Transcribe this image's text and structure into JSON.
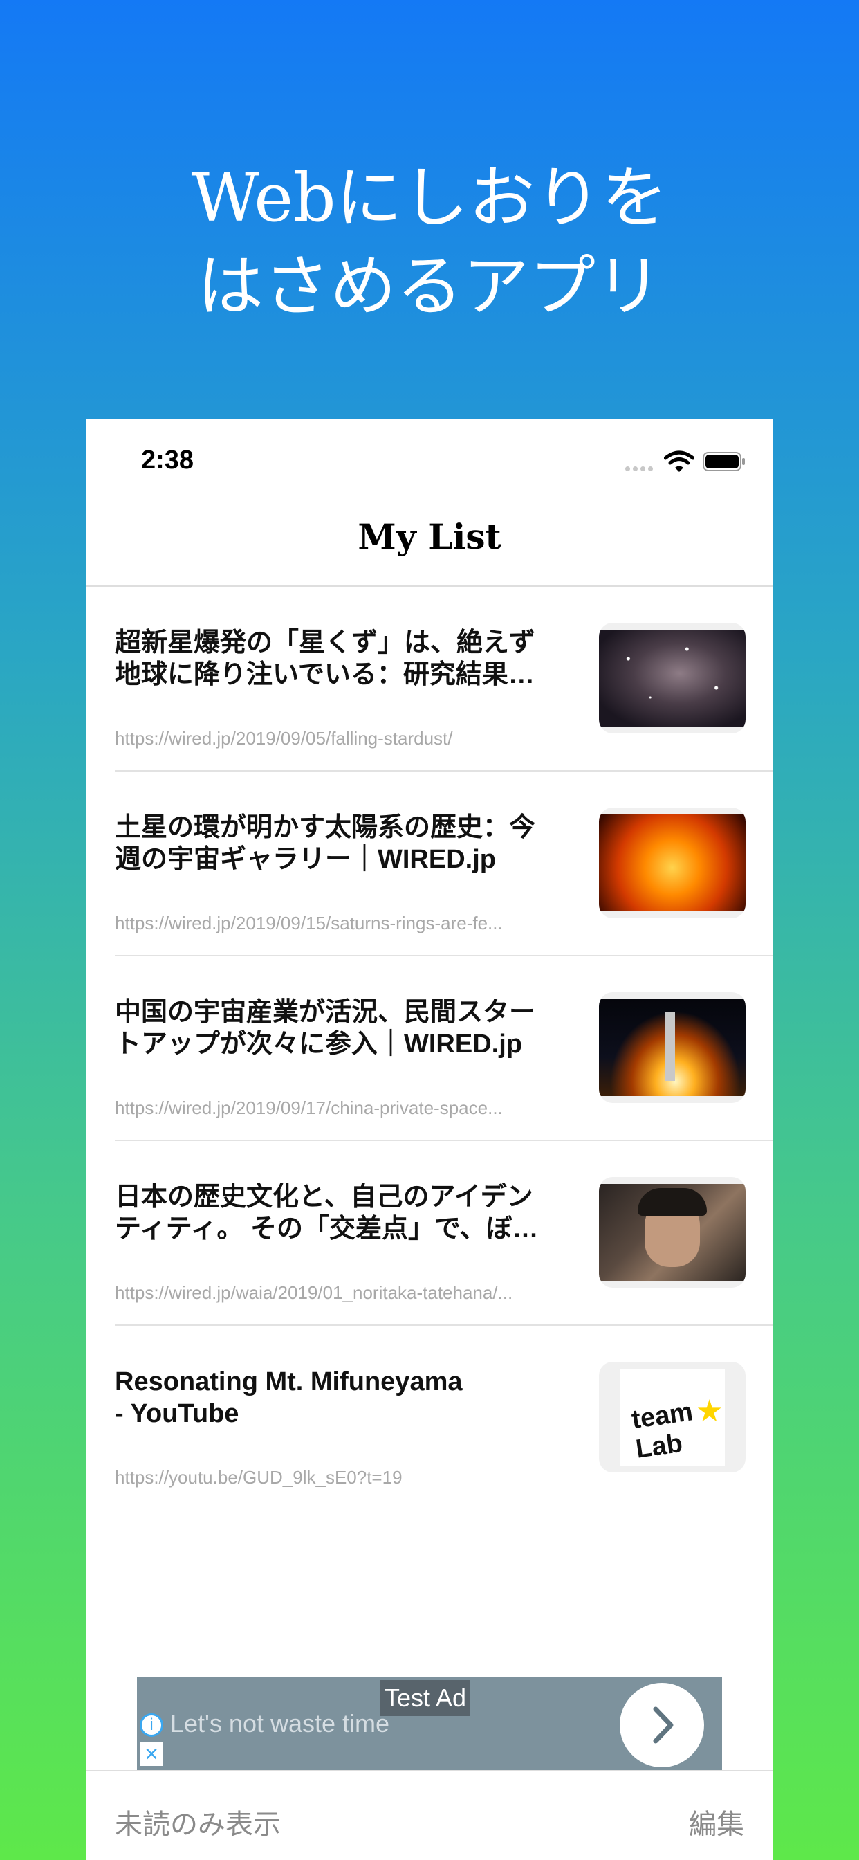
{
  "headline": {
    "line1": "Webにしおりを",
    "line2": "はさめるアプリ"
  },
  "status_bar": {
    "time": "2:38"
  },
  "nav": {
    "title": "My List"
  },
  "items": [
    {
      "title": "超新星爆発の「星くず」は、絶えず\n地球に降り注いでいる：研究結果…",
      "url": "https://wired.jp/2019/09/05/falling-stardust/",
      "thumb": "stars-image"
    },
    {
      "title": "土星の環が明かす太陽系の歴史：今\n週の宇宙ギャラリー｜WIRED.jp",
      "url": "https://wired.jp/2019/09/15/saturns-rings-are-fe...",
      "thumb": "sun-image"
    },
    {
      "title": "中国の宇宙産業が活況、民間スター\nトアップが次々に参入｜WIRED.jp",
      "url": "https://wired.jp/2019/09/17/china-private-space...",
      "thumb": "rocket-launch-image"
    },
    {
      "title": "日本の歴史文化と、自己のアイデン\nティティ。 その「交差点」で、ぼ…",
      "url": "https://wired.jp/waia/2019/01_noritaka-tatehana/...",
      "thumb": "portrait-image"
    },
    {
      "title": "Resonating Mt. Mifuneyama\n- YouTube",
      "url": "https://youtu.be/GUD_9lk_sE0?t=19",
      "thumb": "teamlab-logo",
      "logo_text": "team Lab"
    }
  ],
  "ad": {
    "label": "Test Ad",
    "text": "Let's not waste time"
  },
  "bottom_bar": {
    "unread_label": "未読のみ表示",
    "edit_label": "編集"
  },
  "colors": {
    "gradient_top": "#1479f5",
    "gradient_bottom": "#5ee84a",
    "ad_background": "#7d929d"
  }
}
